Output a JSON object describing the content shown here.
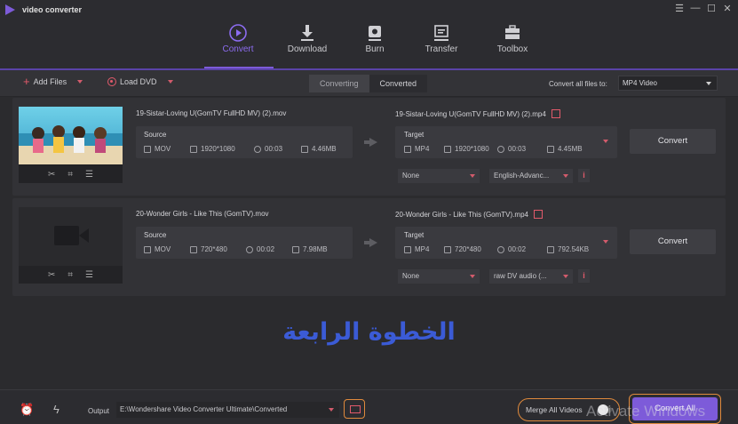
{
  "app": {
    "title": "video converter"
  },
  "window_controls": [
    "☰",
    "—",
    "☐",
    "✕"
  ],
  "nav": [
    {
      "label": "Convert",
      "icon": "convert-icon",
      "active": true
    },
    {
      "label": "Download",
      "icon": "download-icon",
      "active": false
    },
    {
      "label": "Burn",
      "icon": "burn-disc-icon",
      "active": false
    },
    {
      "label": "Transfer",
      "icon": "transfer-icon",
      "active": false
    },
    {
      "label": "Toolbox",
      "icon": "toolbox-icon",
      "active": false
    }
  ],
  "toolbar": {
    "add_files": "Add Files",
    "load_dvd": "Load DVD",
    "tab_converting": "Converting",
    "tab_converted": "Converted",
    "convert_all_label": "Convert all files to:",
    "format": "MP4 Video"
  },
  "items": [
    {
      "source_name": "19-Sistar-Loving U(GomTV FullHD MV) (2).mov",
      "source": {
        "label": "Source",
        "format": "MOV",
        "resolution": "1920*1080",
        "duration": "00:03",
        "size": "4.46MB"
      },
      "target_name": "19-Sistar-Loving U(GomTV FullHD MV) (2).mp4",
      "target": {
        "label": "Target",
        "format": "MP4",
        "resolution": "1920*1080",
        "duration": "00:03",
        "size": "4.45MB"
      },
      "convert": "Convert",
      "subtitle": "None",
      "audio": "English-Advanc...",
      "info": "i"
    },
    {
      "source_name": "20-Wonder Girls - Like This (GomTV).mov",
      "source": {
        "label": "Source",
        "format": "MOV",
        "resolution": "720*480",
        "duration": "00:02",
        "size": "7.98MB"
      },
      "target_name": "20-Wonder Girls - Like This (GomTV).mp4",
      "target": {
        "label": "Target",
        "format": "MP4",
        "resolution": "720*480",
        "duration": "00:02",
        "size": "792.54KB"
      },
      "convert": "Convert",
      "subtitle": "None",
      "audio": "raw DV audio (...",
      "info": "i"
    }
  ],
  "watermark_text": "الخطوة الرابعة",
  "bottom": {
    "output_label": "Output",
    "output_path": "E:\\Wondershare Video Converter Ultimate\\Converted",
    "merge_label": "Merge All Videos",
    "convert_all": "Convert All",
    "activate_overlay": "Activate Windows"
  }
}
